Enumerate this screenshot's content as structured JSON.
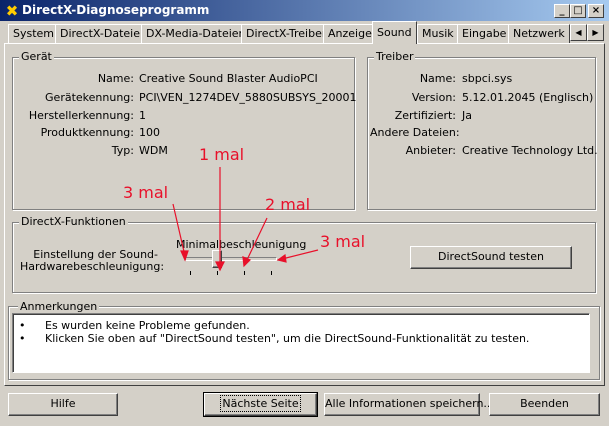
{
  "window": {
    "title": "DirectX-Diagnoseprogramm",
    "controls": {
      "minimize": "_",
      "maximize": "□",
      "close": "×"
    }
  },
  "tabs": [
    "System",
    "DirectX-Dateien",
    "DX-Media-Dateien",
    "DirectX-Treiber",
    "Anzeige",
    "Sound",
    "Musik",
    "Eingabe",
    "Netzwerk"
  ],
  "active_tab": "Sound",
  "tab_scroll": {
    "left": "◀",
    "right": "▶"
  },
  "device": {
    "legend": "Gerät",
    "fields": [
      {
        "label": "Name:",
        "value": "Creative Sound Blaster AudioPCI"
      },
      {
        "label": "Gerätekennung:",
        "value": "PCI\\VEN_1274DEV_5880SUBSYS_20001"
      },
      {
        "label": "Herstellerkennung:",
        "value": "1"
      },
      {
        "label": "Produktkennung:",
        "value": "100"
      },
      {
        "label": "Typ:",
        "value": "WDM"
      }
    ]
  },
  "driver": {
    "legend": "Treiber",
    "fields": [
      {
        "label": "Name:",
        "value": "sbpci.sys"
      },
      {
        "label": "Version:",
        "value": "5.12.01.2045 (Englisch)"
      },
      {
        "label": "Zertifiziert:",
        "value": "Ja"
      },
      {
        "label": "Andere Dateien:",
        "value": ""
      },
      {
        "label": "Anbieter:",
        "value": "Creative Technology Ltd."
      }
    ]
  },
  "directx": {
    "legend": "DirectX-Funktionen",
    "setting_label_1": "Einstellung der Sound-",
    "setting_label_2": "Hardwarebeschleunigung:",
    "slider_caption": "Minimalbeschleunigung",
    "slider_value": "Minimalbeschleunigung",
    "slider_level": 1,
    "slider_positions": 4,
    "test_button": "DirectSound testen"
  },
  "annotations": [
    "3 mal",
    "1 mal",
    "2 mal",
    "3 mal"
  ],
  "notes": {
    "legend": "Anmerkungen",
    "items": [
      "Es wurden keine Probleme gefunden.",
      "Klicken Sie oben auf \"DirectSound testen\", um die DirectSound-Funktionalität zu testen."
    ]
  },
  "buttons": {
    "help": "Hilfe",
    "next": "Nächste Seite",
    "save_all": "Alle Informationen speichern...",
    "exit": "Beenden"
  },
  "colors": {
    "annotation": "#e8102a",
    "titlebar_start": "#0a246a",
    "titlebar_end": "#a6caf0"
  }
}
